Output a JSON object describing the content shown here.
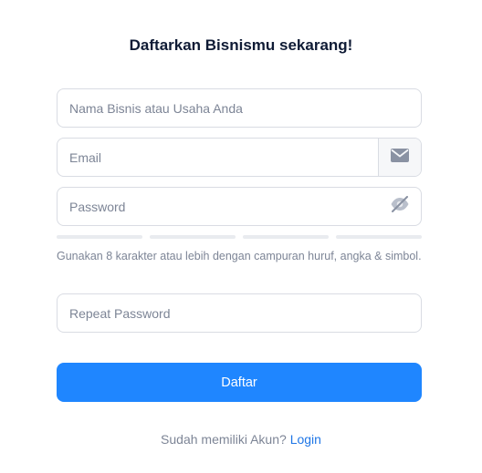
{
  "form": {
    "title": "Daftarkan Bisnismu sekarang!",
    "business_name": {
      "placeholder": "Nama Bisnis atau Usaha Anda",
      "value": ""
    },
    "email": {
      "placeholder": "Email",
      "value": "",
      "icon": "envelope-icon"
    },
    "password": {
      "placeholder": "Password",
      "value": "",
      "icon": "eye-slash-icon"
    },
    "password_strength": {
      "segments": 4,
      "filled": 0
    },
    "password_hint": "Gunakan 8 karakter atau lebih dengan campuran huruf, angka & simbol.",
    "repeat_password": {
      "placeholder": "Repeat Password",
      "value": ""
    },
    "submit_label": "Daftar"
  },
  "footer": {
    "prompt": "Sudah memiliki Akun?",
    "login_link": "Login"
  },
  "colors": {
    "primary": "#1f86ff",
    "link": "#1f76e6",
    "title": "#0f1b35",
    "muted": "#7d8596",
    "border": "#d9dce3"
  }
}
